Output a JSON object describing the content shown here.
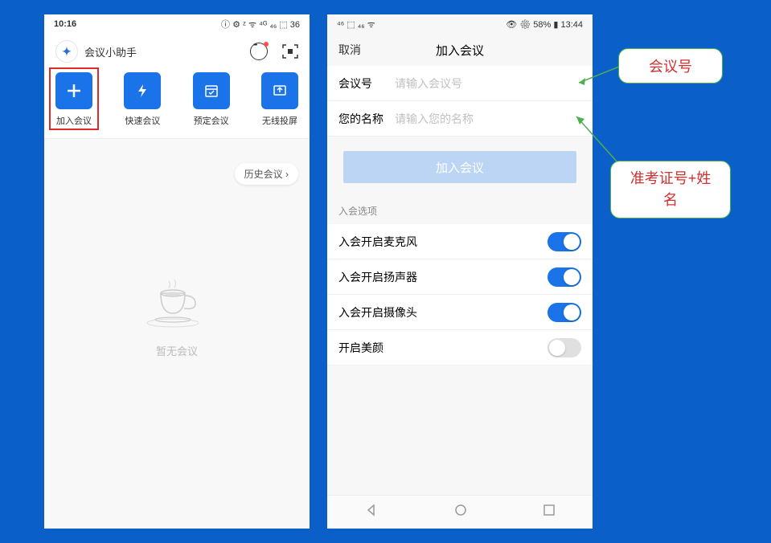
{
  "phone1": {
    "status": {
      "time": "10:16",
      "right": "ⓘ ⚙ ᶻ ᯤ ⁴ᴳ ₄₆ ⬚ 36"
    },
    "header": {
      "title": "会议小助手"
    },
    "actions": [
      {
        "label": "加入会议"
      },
      {
        "label": "快速会议"
      },
      {
        "label": "预定会议"
      },
      {
        "label": "无线投屏"
      }
    ],
    "history_button": "历史会议 ›",
    "empty_text": "暂无会议"
  },
  "phone2": {
    "status": {
      "left": "⁴⁶ ⬚ ₄₆ ᯤ",
      "right": "👁 ⚙ 58% ▮ 13:44"
    },
    "nav": {
      "cancel": "取消",
      "title": "加入会议"
    },
    "form": {
      "meeting_id_label": "会议号",
      "meeting_id_placeholder": "请输入会议号",
      "name_label": "您的名称",
      "name_placeholder": "请输入您的名称"
    },
    "join_button": "加入会议",
    "options_title": "入会选项",
    "options": [
      {
        "label": "入会开启麦克风",
        "on": true
      },
      {
        "label": "入会开启扬声器",
        "on": true
      },
      {
        "label": "入会开启摄像头",
        "on": true
      },
      {
        "label": "开启美颜",
        "on": false
      }
    ]
  },
  "callouts": {
    "c1": "会议号",
    "c2": "准考证号+姓名"
  }
}
